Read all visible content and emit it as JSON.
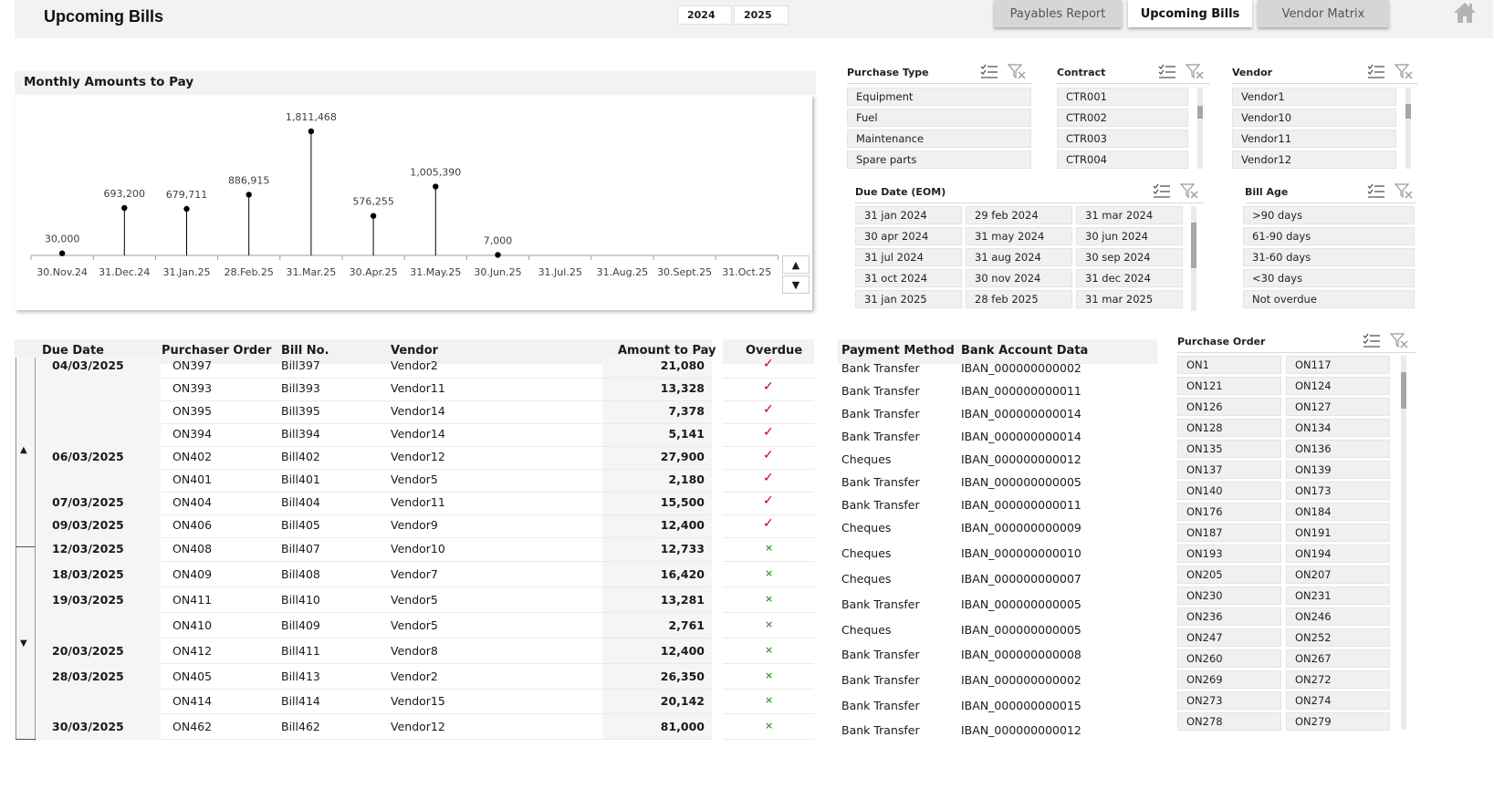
{
  "header": {
    "title": "Upcoming Bills",
    "years": [
      "2024",
      "2025"
    ],
    "tabs": [
      {
        "label": "Payables Report",
        "active": false
      },
      {
        "label": "Upcoming Bills",
        "active": true
      },
      {
        "label": "Vendor Matrix",
        "active": false
      }
    ],
    "home_icon": "home-icon"
  },
  "chart_data": {
    "type": "line",
    "title": "Monthly Amounts to Pay",
    "categories": [
      "30.Nov.24",
      "31.Dec.24",
      "31.Jan.25",
      "28.Feb.25",
      "31.Mar.25",
      "30.Apr.25",
      "31.May.25",
      "30.Jun.25",
      "31.Jul.25",
      "31.Aug.25",
      "30.Sept.25",
      "31.Oct.25"
    ],
    "values": [
      30000,
      693200,
      679711,
      886915,
      1811468,
      576255,
      1005390,
      7000,
      null,
      null,
      null,
      null
    ],
    "labels": [
      "30,000",
      "693,200",
      "679,711",
      "886,915",
      "1,811,468",
      "576,255",
      "1,005,390",
      "7,000",
      "",
      "",
      "",
      ""
    ],
    "ylim": [
      0,
      2000000
    ],
    "grid": false
  },
  "slicers": {
    "purchase_type": {
      "title": "Purchase Type",
      "items": [
        "Equipment",
        "Fuel",
        "Maintenance",
        "Spare parts"
      ]
    },
    "contract": {
      "title": "Contract",
      "items": [
        "CTR001",
        "CTR002",
        "CTR003",
        "CTR004"
      ]
    },
    "vendor": {
      "title": "Vendor",
      "items": [
        "Vendor1",
        "Vendor10",
        "Vendor11",
        "Vendor12"
      ]
    },
    "due_date": {
      "title": "Due Date (EOM)",
      "items": [
        "31 jan 2024",
        "29 feb 2024",
        "31 mar 2024",
        "30 apr 2024",
        "31 may 2024",
        "30 jun 2024",
        "31 jul 2024",
        "31 aug 2024",
        "30 sep 2024",
        "31 oct 2024",
        "30 nov 2024",
        "31 dec 2024",
        "31 jan 2025",
        "28 feb 2025",
        "31 mar 2025"
      ]
    },
    "bill_age": {
      "title": "Bill Age",
      "items": [
        ">90 days",
        "61-90 days",
        "31-60 days",
        "<30 days",
        "Not overdue"
      ]
    },
    "purchase_order": {
      "title": "Purchase Order",
      "items": [
        "ON1",
        "ON117",
        "ON121",
        "ON124",
        "ON126",
        "ON127",
        "ON128",
        "ON134",
        "ON135",
        "ON136",
        "ON137",
        "ON139",
        "ON140",
        "ON173",
        "ON176",
        "ON184",
        "ON187",
        "ON191",
        "ON193",
        "ON194",
        "ON205",
        "ON207",
        "ON230",
        "ON231",
        "ON236",
        "ON246",
        "ON247",
        "ON252",
        "ON260",
        "ON267",
        "ON269",
        "ON272",
        "ON273",
        "ON274",
        "ON278",
        "ON279"
      ]
    }
  },
  "bills": {
    "headers": {
      "due_date": "Due Date",
      "order": "Purchaser Order",
      "bill": "Bill No.",
      "vendor": "Vendor",
      "amount": "Amount to Pay",
      "overdue": "Overdue",
      "payment": "Payment Method",
      "bank": "Bank Account Data"
    },
    "rows": [
      {
        "date": "04/03/2025",
        "order": "ON397",
        "bill": "Bill397",
        "vendor": "Vendor2",
        "amount": "21,080",
        "overdue": true,
        "payment": "Bank Transfer",
        "bank": "IBAN_000000000002"
      },
      {
        "date": "",
        "order": "ON393",
        "bill": "Bill393",
        "vendor": "Vendor11",
        "amount": "13,328",
        "overdue": true,
        "payment": "Bank Transfer",
        "bank": "IBAN_000000000011"
      },
      {
        "date": "",
        "order": "ON395",
        "bill": "Bill395",
        "vendor": "Vendor14",
        "amount": "7,378",
        "overdue": true,
        "payment": "Bank Transfer",
        "bank": "IBAN_000000000014"
      },
      {
        "date": "",
        "order": "ON394",
        "bill": "Bill394",
        "vendor": "Vendor14",
        "amount": "5,141",
        "overdue": true,
        "payment": "Bank Transfer",
        "bank": "IBAN_000000000014"
      },
      {
        "date": "06/03/2025",
        "order": "ON402",
        "bill": "Bill402",
        "vendor": "Vendor12",
        "amount": "27,900",
        "overdue": true,
        "payment": "Cheques",
        "bank": "IBAN_000000000012"
      },
      {
        "date": "",
        "order": "ON401",
        "bill": "Bill401",
        "vendor": "Vendor5",
        "amount": "2,180",
        "overdue": true,
        "payment": "Bank Transfer",
        "bank": "IBAN_000000000005"
      },
      {
        "date": "07/03/2025",
        "order": "ON404",
        "bill": "Bill404",
        "vendor": "Vendor11",
        "amount": "15,500",
        "overdue": true,
        "payment": "Bank Transfer",
        "bank": "IBAN_000000000011"
      },
      {
        "date": "09/03/2025",
        "order": "ON406",
        "bill": "Bill405",
        "vendor": "Vendor9",
        "amount": "12,400",
        "overdue": true,
        "payment": "Cheques",
        "bank": "IBAN_000000000009"
      },
      {
        "date": "12/03/2025",
        "order": "ON408",
        "bill": "Bill407",
        "vendor": "Vendor10",
        "amount": "12,733",
        "overdue": false,
        "payment": "Cheques",
        "bank": "IBAN_000000000010"
      },
      {
        "date": "18/03/2025",
        "order": "ON409",
        "bill": "Bill408",
        "vendor": "Vendor7",
        "amount": "16,420",
        "overdue": false,
        "payment": "Cheques",
        "bank": "IBAN_000000000007"
      },
      {
        "date": "19/03/2025",
        "order": "ON411",
        "bill": "Bill410",
        "vendor": "Vendor5",
        "amount": "13,281",
        "overdue": false,
        "payment": "Bank Transfer",
        "bank": "IBAN_000000000005"
      },
      {
        "date": "",
        "order": "ON410",
        "bill": "Bill409",
        "vendor": "Vendor5",
        "amount": "2,761",
        "overdue": false,
        "payment": "Cheques",
        "bank": "IBAN_000000000005"
      },
      {
        "date": "20/03/2025",
        "order": "ON412",
        "bill": "Bill411",
        "vendor": "Vendor8",
        "amount": "12,400",
        "overdue": false,
        "payment": "Bank Transfer",
        "bank": "IBAN_000000000008"
      },
      {
        "date": "28/03/2025",
        "order": "ON405",
        "bill": "Bill413",
        "vendor": "Vendor2",
        "amount": "26,350",
        "overdue": false,
        "payment": "Bank Transfer",
        "bank": "IBAN_000000000002"
      },
      {
        "date": "",
        "order": "ON414",
        "bill": "Bill414",
        "vendor": "Vendor15",
        "amount": "20,142",
        "overdue": false,
        "payment": "Bank Transfer",
        "bank": "IBAN_000000000015"
      },
      {
        "date": "30/03/2025",
        "order": "ON462",
        "bill": "Bill462",
        "vendor": "Vendor12",
        "amount": "81,000",
        "overdue": false,
        "payment": "Bank Transfer",
        "bank": "IBAN_000000000012"
      }
    ]
  }
}
